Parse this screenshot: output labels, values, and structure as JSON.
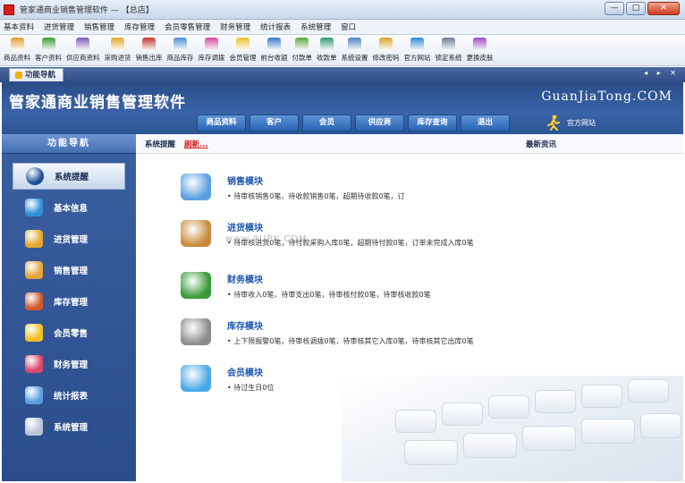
{
  "window": {
    "title": "管家通商业销售管理软件 — 【总店】",
    "min": "—",
    "max": "□",
    "close": "✕"
  },
  "menu": [
    "基本资料",
    "进货管理",
    "销售管理",
    "库存管理",
    "会员零售管理",
    "财务管理",
    "统计报表",
    "系统管理",
    "窗口"
  ],
  "toolbar": [
    {
      "label": "商品资料",
      "color": "#e49b2a"
    },
    {
      "label": "客户资料",
      "color": "#3a9a3a"
    },
    {
      "label": "供应商资料",
      "color": "#7c5cb8"
    },
    {
      "label": "采购进货",
      "color": "#e3a82d"
    },
    {
      "label": "销售出库",
      "color": "#c8342b"
    },
    {
      "label": "商品库存",
      "color": "#4e8fd6"
    },
    {
      "label": "库存调拨",
      "color": "#d64a9a"
    },
    {
      "label": "会员管理",
      "color": "#e6c12a"
    },
    {
      "label": "前台收银",
      "color": "#3a78c9"
    },
    {
      "label": "付款单",
      "color": "#5aa83a"
    },
    {
      "label": "收款单",
      "color": "#2f9a6e"
    },
    {
      "label": "系统设置",
      "color": "#4d7fc0"
    },
    {
      "label": "修改密码",
      "color": "#d9a52a"
    },
    {
      "label": "官方网站",
      "color": "#2b8bd8"
    },
    {
      "label": "锁定系统",
      "color": "#6b7a99"
    },
    {
      "label": "更换皮肤",
      "color": "#9a4bc8"
    }
  ],
  "tab": {
    "label": "功能导航",
    "controls": "◂ ▸ ✕"
  },
  "header": {
    "brand": "管家通商业销售管理软件",
    "site": "GuanJiaTong.COM",
    "nav": [
      "商品资料",
      "客户",
      "会员",
      "供应商",
      "库存查询",
      "退出"
    ],
    "official": "官方网站"
  },
  "sidebar": {
    "title": "功能导航",
    "items": [
      {
        "label": "系统提醒",
        "icon": "info-icon",
        "color": "#1f4f9a"
      },
      {
        "label": "基本信息",
        "icon": "boxes-icon",
        "color": "#2f8fd8"
      },
      {
        "label": "进货管理",
        "icon": "stock-in-icon",
        "color": "#e3a82d"
      },
      {
        "label": "销售管理",
        "icon": "sales-icon",
        "color": "#e7a33a"
      },
      {
        "label": "库存管理",
        "icon": "warehouse-icon",
        "color": "#d05a2a"
      },
      {
        "label": "会员零售",
        "icon": "member-icon",
        "color": "#f0c020"
      },
      {
        "label": "财务管理",
        "icon": "finance-icon",
        "color": "#d94a6a"
      },
      {
        "label": "统计报表",
        "icon": "report-icon",
        "color": "#5aa0e0"
      },
      {
        "label": "系统管理",
        "icon": "gears-icon",
        "color": "#b8c4d6"
      }
    ]
  },
  "main": {
    "header_left": "系统提醒",
    "refresh": "刷新...",
    "news": "最新资讯",
    "watermark": "www.9UPK.COM",
    "modules": [
      {
        "title": "销售模块",
        "line": "• 待审核销售0笔，待收款销售0笔，超期待收款0笔，订"
      },
      {
        "title": "进货模块",
        "line": "• 待审核进货0笔，待付款采购入库0笔，超期待付款0笔，订单未完成入库0笔"
      },
      {
        "title": "财务模块",
        "line": "• 待审收入0笔，待审支出0笔，待审核付款0笔，待审核收款0笔"
      },
      {
        "title": "库存模块",
        "line": "• 上下限报警0笔，待审核调拨0笔，待审核其它入库0笔，待审核其它出库0笔"
      },
      {
        "title": "会员模块",
        "line": "• 待过生日0位"
      }
    ]
  }
}
